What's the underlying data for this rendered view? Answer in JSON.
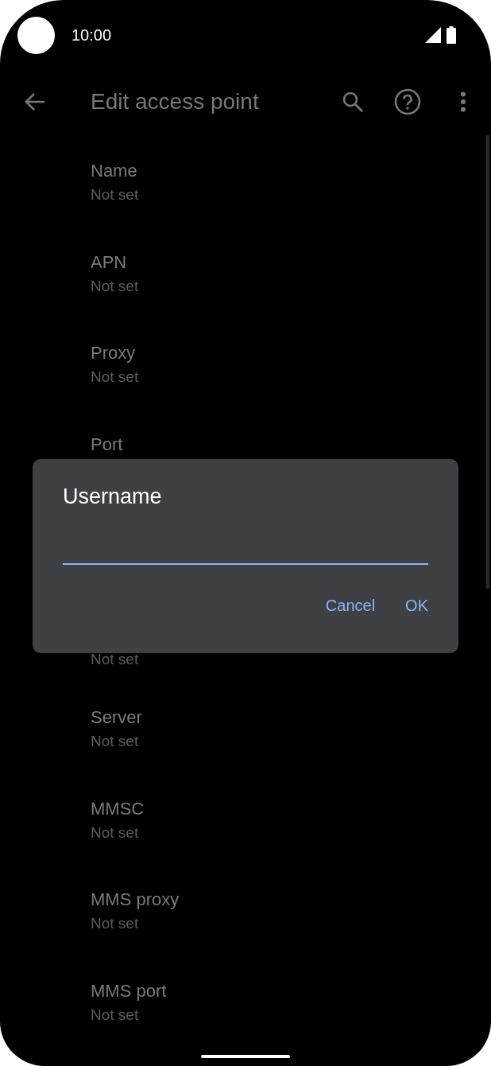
{
  "status_bar": {
    "time": "10:00"
  },
  "toolbar": {
    "title": "Edit access point"
  },
  "settings": [
    {
      "title": "Name",
      "value": "Not set"
    },
    {
      "title": "APN",
      "value": "Not set"
    },
    {
      "title": "Proxy",
      "value": "Not set"
    },
    {
      "title": "Port"
    },
    {
      "value": "Not set"
    },
    {
      "title": "Server",
      "value": "Not set"
    },
    {
      "title": "MMSC",
      "value": "Not set"
    },
    {
      "title": "MMS proxy",
      "value": "Not set"
    },
    {
      "title": "MMS port",
      "value": "Not set"
    }
  ],
  "dialog": {
    "title": "Username",
    "field": {
      "focused": true
    },
    "buttons": [
      "Cancel",
      "OK"
    ]
  }
}
